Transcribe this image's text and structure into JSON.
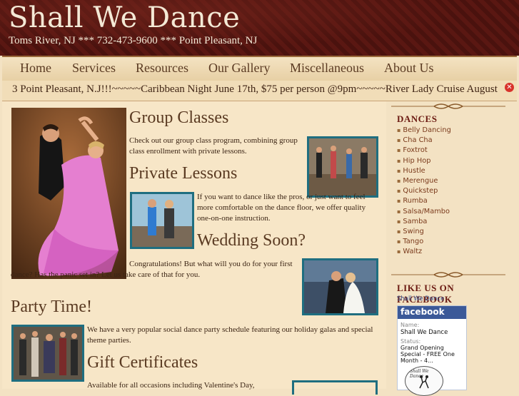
{
  "header": {
    "title": "Shall We Dance",
    "contact": "Toms River, NJ *** 732-473-9600 *** Point Pleasant, NJ"
  },
  "nav": [
    "Home",
    "Services",
    "Resources",
    "Our Gallery",
    "Miscellaneous",
    "About Us"
  ],
  "marquee": {
    "text": "3 Point Pleasant, N.J!!!~~~~~Caribbean Night June 17th, $75 per person @9pm~~~~~River Lady Cruise August"
  },
  "sections": {
    "group": {
      "title": "Group Classes",
      "text": "Check out our group class program, combining group class enrollment with private lessons."
    },
    "private": {
      "title": "Private Lessons",
      "text": "If you want to dance like the pros, or just want to feel more comfortable on the dance floor, we offer quality one-on-one instruction."
    },
    "wedding": {
      "title": "Wedding Soon?",
      "text": "Congratulations! But what will you do for your first dance? Has the panic set in? Let us take care of that for you."
    },
    "party": {
      "title": "Party Time!",
      "text": "We have a very popular social dance party schedule featuring our holiday galas and special theme parties."
    },
    "gift": {
      "title": "Gift Certificates",
      "text": "Available for all occasions including Valentine's Day,"
    }
  },
  "sidebar": {
    "dances_heading": "DANCES",
    "dances": [
      "Belly Dancing",
      "Cha Cha",
      "Foxtrot",
      "Hip Hop",
      "Hustle",
      "Merengue",
      "Quickstep",
      "Rumba",
      "Salsa/Mambo",
      "Samba",
      "Swing",
      "Tango",
      "Waltz"
    ],
    "facebook_heading": "LIKE US ON FACEBOOK",
    "facebook": {
      "page_link": "Shall We Dance",
      "logo": "facebook",
      "name_label": "Name:",
      "name_value": "Shall We Dance",
      "status_label": "Status:",
      "status_value": "Grand Opening Special - FREE One Month - 4...",
      "badge_text": "Shall We Dance"
    }
  },
  "colors": {
    "header_bg": "#4d140f",
    "page_bg": "#f3e2c3",
    "photo_border": "#1f6e80",
    "sidebar_heading": "#6b1a12",
    "facebook_blue": "#3b5998"
  }
}
